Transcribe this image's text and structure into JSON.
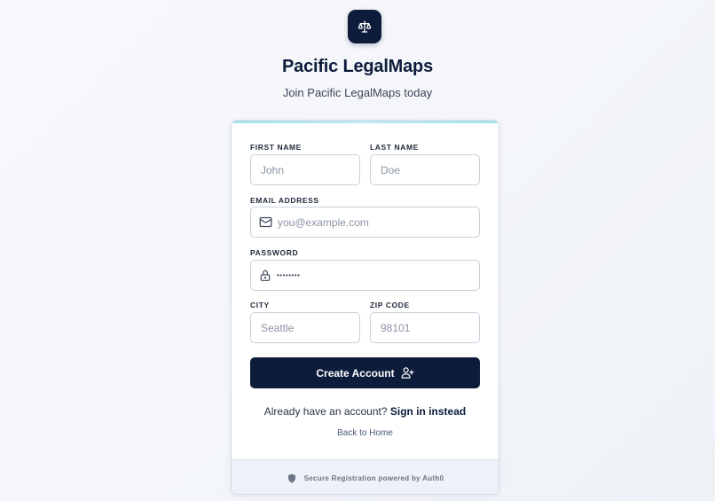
{
  "brand": {
    "title": "Pacific LegalMaps",
    "subtitle": "Join Pacific LegalMaps today",
    "logo_icon": "scales-icon",
    "accent_color": "#0c1c3a",
    "topbar_color": "#a5e0ee"
  },
  "form": {
    "first_name": {
      "label": "FIRST NAME",
      "placeholder": "John"
    },
    "last_name": {
      "label": "LAST NAME",
      "placeholder": "Doe"
    },
    "email": {
      "label": "EMAIL ADDRESS",
      "placeholder": "you@example.com",
      "icon": "mail-icon"
    },
    "password": {
      "label": "PASSWORD",
      "value": "••••••••",
      "icon": "lock-icon"
    },
    "city": {
      "label": "CITY",
      "placeholder": "Seattle"
    },
    "zip": {
      "label": "ZIP CODE",
      "placeholder": "98101"
    },
    "submit_label": "Create Account",
    "submit_icon": "user-plus-icon"
  },
  "links": {
    "signin_prompt": "Already have an account?",
    "signin_label": "Sign in instead",
    "back_label": "Back to Home"
  },
  "footer": {
    "text": "Secure Registration powered by Auth0",
    "icon": "shield-icon"
  }
}
